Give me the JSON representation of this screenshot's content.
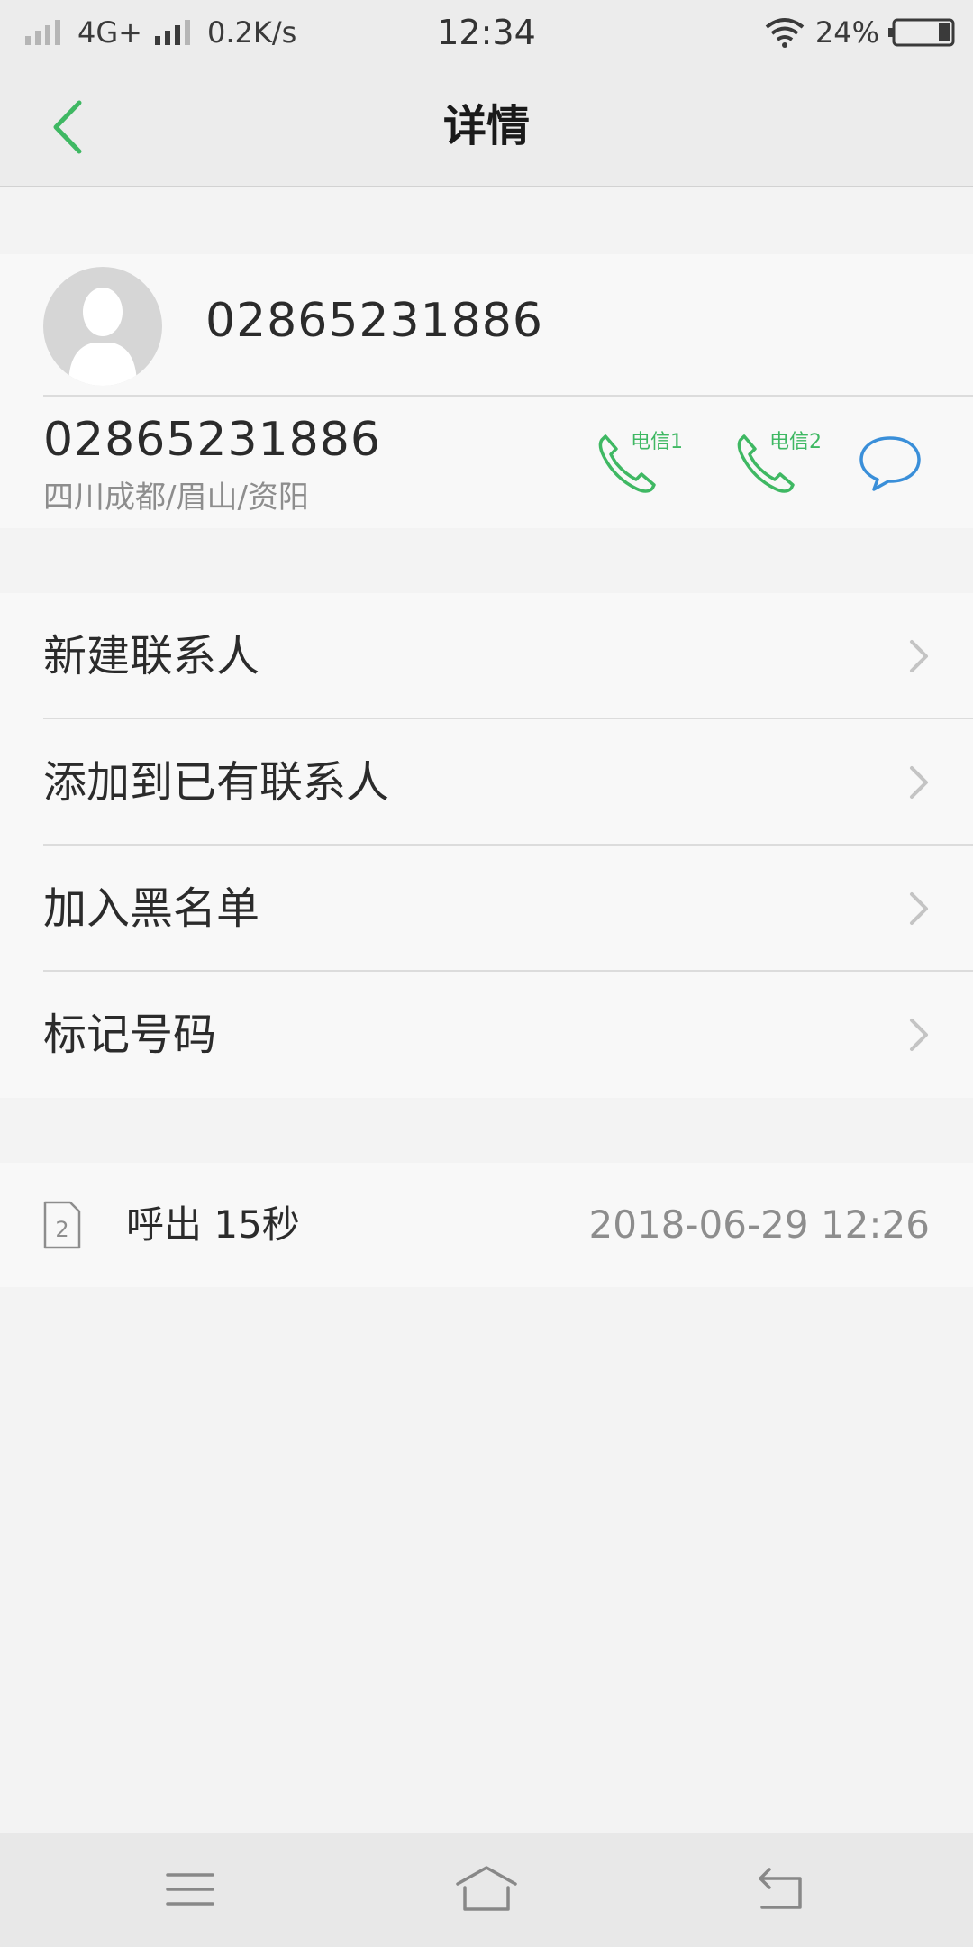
{
  "status_bar": {
    "network_type": "4G+",
    "speed": "0.2K/s",
    "time": "12:34",
    "battery": "24%",
    "icons": [
      "signal-icon",
      "wifi-icon",
      "battery-icon"
    ]
  },
  "header": {
    "title": "详情",
    "back_icon": "chevron-left-icon"
  },
  "contact": {
    "name": "02865231886",
    "number": "02865231886",
    "location": "四川成都/眉山/资阳",
    "call_sim1_label": "电信1",
    "call_sim2_label": "电信2",
    "accent_color": "#3fb863",
    "message_color": "#3a8fd9"
  },
  "menu": {
    "items": [
      {
        "label": "新建联系人"
      },
      {
        "label": "添加到已有联系人"
      },
      {
        "label": "加入黑名单"
      },
      {
        "label": "标记号码"
      }
    ]
  },
  "call_log": {
    "sim": "2",
    "type": "呼出 15秒",
    "time": "2018-06-29 12:26"
  },
  "nav_bar": {
    "icons": [
      "menu-icon",
      "home-icon",
      "back-icon"
    ]
  }
}
